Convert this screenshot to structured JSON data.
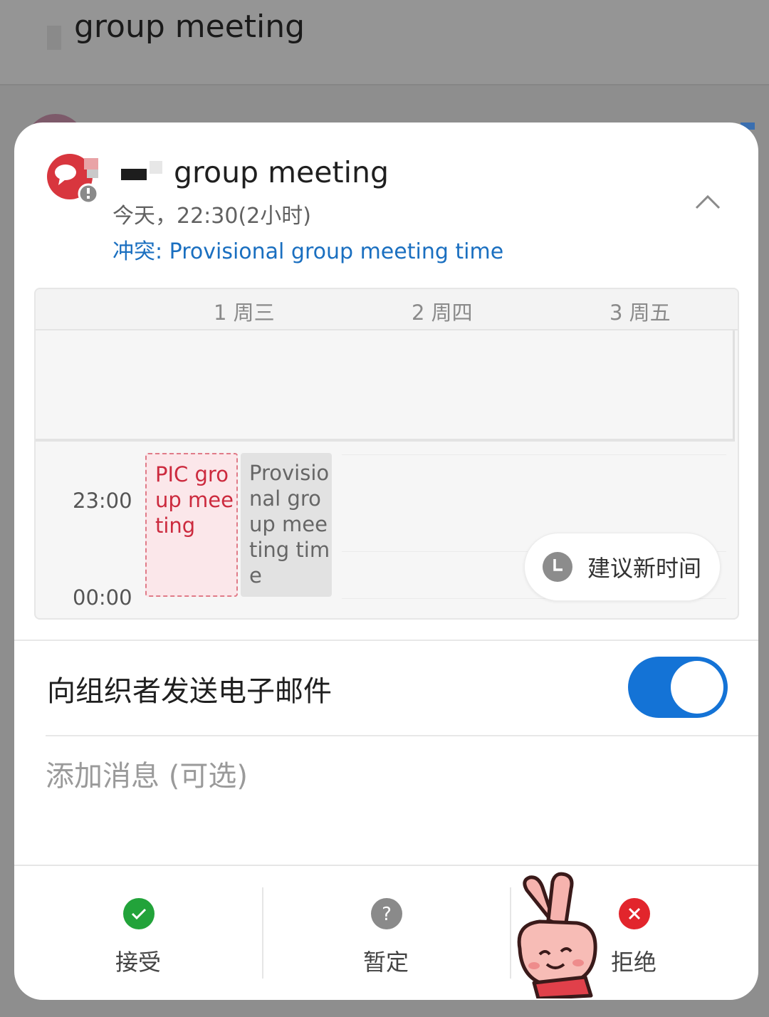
{
  "background": {
    "title": "group meeting"
  },
  "event": {
    "title": "group meeting",
    "time": "今天，22:30(2小时)",
    "conflict": "冲突: Provisional group meeting time"
  },
  "calendar": {
    "days": [
      "1 周三",
      "2 周四",
      "3 周五"
    ],
    "times": [
      "23:00",
      "00:00"
    ],
    "events": {
      "current": "PIC group meeting",
      "conflict": "Provisional group meeting time"
    },
    "suggest_label": "建议新时间"
  },
  "email": {
    "label": "向组织者发送电子邮件",
    "enabled": true
  },
  "message": {
    "placeholder": "添加消息 (可选)"
  },
  "actions": {
    "accept": "接受",
    "tentative": "暂定",
    "decline": "拒绝"
  },
  "colors": {
    "accent": "#1473d6",
    "conflict_text": "#1a6fc0",
    "accept": "#22a33a",
    "tentative": "#8a8a8a",
    "decline": "#e2252c",
    "event_red": "#cc2a3e"
  }
}
